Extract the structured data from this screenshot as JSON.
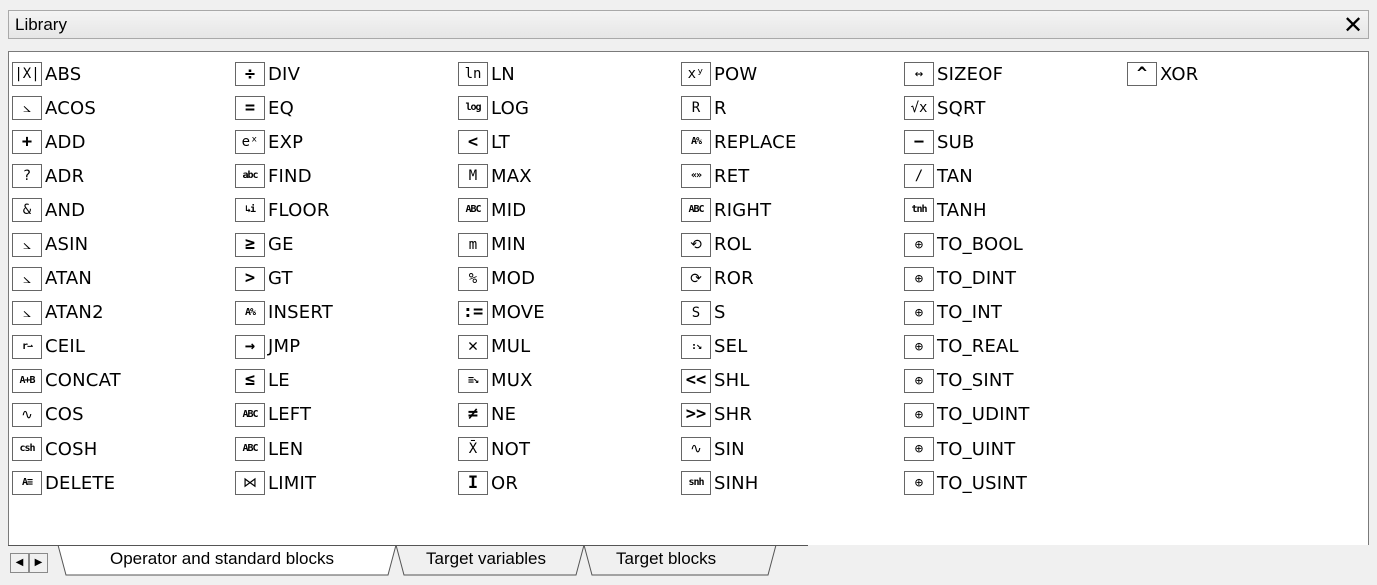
{
  "window": {
    "title": "Library",
    "close_glyph": "✕"
  },
  "library": {
    "columns": [
      [
        {
          "label": "ABS",
          "icon": "|X|",
          "icon_name": "abs-icon"
        },
        {
          "label": "ACOS",
          "icon": "⦣",
          "icon_name": "acos-icon"
        },
        {
          "label": "ADD",
          "icon": "+",
          "icon_name": "add-icon"
        },
        {
          "label": "ADR",
          "icon": "?",
          "icon_name": "adr-icon"
        },
        {
          "label": "AND",
          "icon": "&",
          "icon_name": "and-icon"
        },
        {
          "label": "ASIN",
          "icon": "⦣",
          "icon_name": "asin-icon"
        },
        {
          "label": "ATAN",
          "icon": "⦣",
          "icon_name": "atan-icon"
        },
        {
          "label": "ATAN2",
          "icon": "⦣",
          "icon_name": "atan2-icon"
        },
        {
          "label": "CEIL",
          "icon": "r⇀",
          "icon_name": "ceil-icon"
        },
        {
          "label": "CONCAT",
          "icon": "A+B",
          "icon_name": "concat-icon"
        },
        {
          "label": "COS",
          "icon": "∿",
          "icon_name": "cos-icon"
        },
        {
          "label": "COSH",
          "icon": "csh",
          "icon_name": "cosh-icon"
        },
        {
          "label": "DELETE",
          "icon": "A≡",
          "icon_name": "delete-icon"
        }
      ],
      [
        {
          "label": "DIV",
          "icon": "÷",
          "icon_name": "div-icon"
        },
        {
          "label": "EQ",
          "icon": "=",
          "icon_name": "eq-icon"
        },
        {
          "label": "EXP",
          "icon": "eˣ",
          "icon_name": "exp-icon"
        },
        {
          "label": "FIND",
          "icon": "abc",
          "icon_name": "find-icon"
        },
        {
          "label": "FLOOR",
          "icon": "↳i",
          "icon_name": "floor-icon"
        },
        {
          "label": "GE",
          "icon": "≥",
          "icon_name": "ge-icon"
        },
        {
          "label": "GT",
          "icon": ">",
          "icon_name": "gt-icon"
        },
        {
          "label": "INSERT",
          "icon": "A%",
          "icon_name": "insert-icon"
        },
        {
          "label": "JMP",
          "icon": "→",
          "icon_name": "jmp-icon"
        },
        {
          "label": "LE",
          "icon": "≤",
          "icon_name": "le-icon"
        },
        {
          "label": "LEFT",
          "icon": "ABC",
          "icon_name": "left-icon"
        },
        {
          "label": "LEN",
          "icon": "ABC",
          "icon_name": "len-icon"
        },
        {
          "label": "LIMIT",
          "icon": "⋈",
          "icon_name": "limit-icon"
        }
      ],
      [
        {
          "label": "LN",
          "icon": "ln",
          "icon_name": "ln-icon"
        },
        {
          "label": "LOG",
          "icon": "log",
          "icon_name": "log-icon"
        },
        {
          "label": "LT",
          "icon": "<",
          "icon_name": "lt-icon"
        },
        {
          "label": "MAX",
          "icon": "M",
          "icon_name": "max-icon"
        },
        {
          "label": "MID",
          "icon": "ABC",
          "icon_name": "mid-icon"
        },
        {
          "label": "MIN",
          "icon": "m",
          "icon_name": "min-icon"
        },
        {
          "label": "MOD",
          "icon": "%",
          "icon_name": "mod-icon"
        },
        {
          "label": "MOVE",
          "icon": ":=",
          "icon_name": "move-icon"
        },
        {
          "label": "MUL",
          "icon": "✕",
          "icon_name": "mul-icon"
        },
        {
          "label": "MUX",
          "icon": "≡↘",
          "icon_name": "mux-icon"
        },
        {
          "label": "NE",
          "icon": "≠",
          "icon_name": "ne-icon"
        },
        {
          "label": "NOT",
          "icon": "X̄",
          "icon_name": "not-icon"
        },
        {
          "label": "OR",
          "icon": "I",
          "icon_name": "or-icon"
        }
      ],
      [
        {
          "label": "POW",
          "icon": "xʸ",
          "icon_name": "pow-icon"
        },
        {
          "label": "R",
          "icon": "R",
          "icon_name": "r-icon"
        },
        {
          "label": "REPLACE",
          "icon": "A%",
          "icon_name": "replace-icon"
        },
        {
          "label": "RET",
          "icon": "«»",
          "icon_name": "ret-icon"
        },
        {
          "label": "RIGHT",
          "icon": "ABC",
          "icon_name": "right-icon"
        },
        {
          "label": "ROL",
          "icon": "⟲",
          "icon_name": "rol-icon"
        },
        {
          "label": "ROR",
          "icon": "⟳",
          "icon_name": "ror-icon"
        },
        {
          "label": "S",
          "icon": "S",
          "icon_name": "s-icon"
        },
        {
          "label": "SEL",
          "icon": ":↘",
          "icon_name": "sel-icon"
        },
        {
          "label": "SHL",
          "icon": "<<",
          "icon_name": "shl-icon"
        },
        {
          "label": "SHR",
          "icon": ">>",
          "icon_name": "shr-icon"
        },
        {
          "label": "SIN",
          "icon": "∿",
          "icon_name": "sin-icon"
        },
        {
          "label": "SINH",
          "icon": "snh",
          "icon_name": "sinh-icon"
        }
      ],
      [
        {
          "label": "SIZEOF",
          "icon": "↔",
          "icon_name": "sizeof-icon"
        },
        {
          "label": "SQRT",
          "icon": "√x",
          "icon_name": "sqrt-icon"
        },
        {
          "label": "SUB",
          "icon": "−",
          "icon_name": "sub-icon"
        },
        {
          "label": "TAN",
          "icon": "/",
          "icon_name": "tan-icon"
        },
        {
          "label": "TANH",
          "icon": "tnh",
          "icon_name": "tanh-icon"
        },
        {
          "label": "TO_BOOL",
          "icon": "⊕",
          "icon_name": "to-bool-icon"
        },
        {
          "label": "TO_DINT",
          "icon": "⊕",
          "icon_name": "to-dint-icon"
        },
        {
          "label": "TO_INT",
          "icon": "⊕",
          "icon_name": "to-int-icon"
        },
        {
          "label": "TO_REAL",
          "icon": "⊕",
          "icon_name": "to-real-icon"
        },
        {
          "label": "TO_SINT",
          "icon": "⊕",
          "icon_name": "to-sint-icon"
        },
        {
          "label": "TO_UDINT",
          "icon": "⊕",
          "icon_name": "to-udint-icon"
        },
        {
          "label": "TO_UINT",
          "icon": "⊕",
          "icon_name": "to-uint-icon"
        },
        {
          "label": "TO_USINT",
          "icon": "⊕",
          "icon_name": "to-usint-icon"
        }
      ],
      [
        {
          "label": "XOR",
          "icon": "^",
          "icon_name": "xor-icon"
        }
      ]
    ]
  },
  "tabs": {
    "prev_glyph": "◀",
    "next_glyph": "▶",
    "items": [
      {
        "label": "Operator and standard blocks",
        "active": true
      },
      {
        "label": "Target variables",
        "active": false
      },
      {
        "label": "Target blocks",
        "active": false
      }
    ]
  }
}
